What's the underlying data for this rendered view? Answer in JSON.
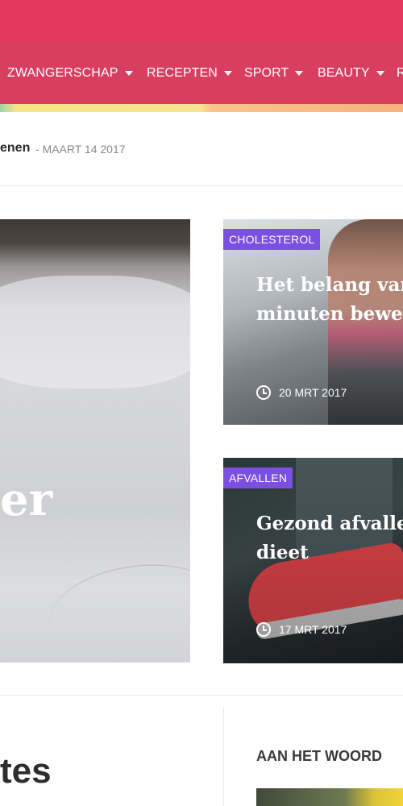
{
  "nav": {
    "items": [
      {
        "label": "ZWANGERSCHAP"
      },
      {
        "label": "RECEPTEN"
      },
      {
        "label": "SPORT"
      },
      {
        "label": "BEAUTY"
      },
      {
        "label": "R"
      }
    ]
  },
  "ticker": {
    "title": "enen",
    "date": "- MAART 14 2017"
  },
  "hero": {
    "title": "er"
  },
  "cards": [
    {
      "category": "CHOLESTEROL",
      "title_line1": "Het belang van",
      "title_line2": "minuten bewe",
      "date": "20 MRT 2017"
    },
    {
      "category": "AFVALLEN",
      "title_line1": "Gezond afvalle",
      "title_line2": "dieet",
      "date": "17 MRT 2017"
    }
  ],
  "sections": {
    "latest_title": "tes",
    "widget_title": "AAN HET WOORD"
  },
  "colors": {
    "topbar": "#e4385f",
    "navbar": "#d83e60",
    "badge": "#7b4fe0"
  },
  "icons": [
    "caret-down-icon",
    "clock-icon"
  ]
}
